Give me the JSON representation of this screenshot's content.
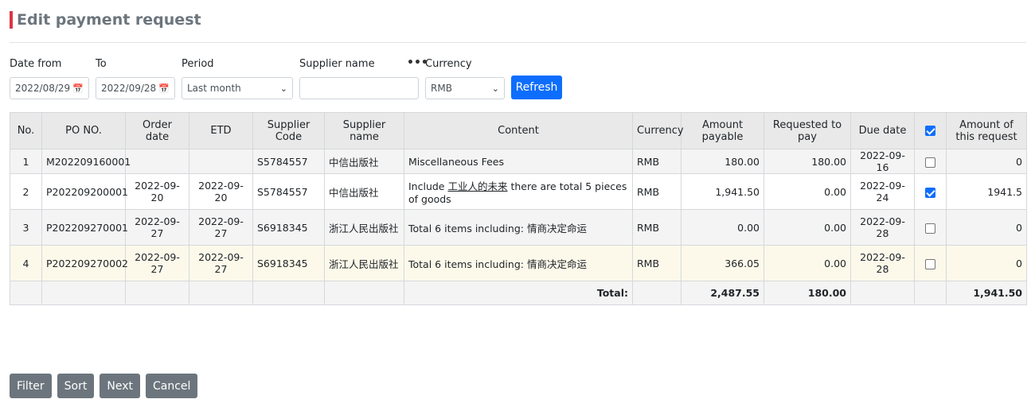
{
  "page": {
    "title": "Edit payment request"
  },
  "filters": {
    "date_from_label": "Date from",
    "to_label": "To",
    "period_label": "Period",
    "supplier_label": "Supplier name",
    "currency_label": "Currency",
    "date_from_value": "2022/08/29",
    "to_value": "2022/09/28",
    "period_value": "Last month",
    "supplier_value": "",
    "currency_value": "RMB",
    "refresh_label": "Refresh",
    "more_label": "•••"
  },
  "table": {
    "headers": {
      "no": "No.",
      "po": "PO NO.",
      "order_date": "Order date",
      "etd": "ETD",
      "supplier_code": "Supplier Code",
      "supplier_name": "Supplier name",
      "content": "Content",
      "currency": "Currency",
      "amount_payable": "Amount payable",
      "requested": "Requested to pay",
      "due_date": "Due date",
      "amount_request": "Amount of this request",
      "select_all_checked": true
    },
    "rows": [
      {
        "no": "1",
        "po": "M202209160001",
        "order_date": "",
        "etd": "",
        "supplier_code": "S5784557",
        "supplier_name": "中信出版社",
        "content_prefix": "Miscellaneous Fees",
        "content_link": "",
        "content_suffix": "",
        "currency": "RMB",
        "amount_payable": "180.00",
        "requested": "180.00",
        "due_date": "2022-09-16",
        "checked": false,
        "amount_request": "0"
      },
      {
        "no": "2",
        "po": "P202209200001",
        "order_date": "2022-09-20",
        "etd": "2022-09-20",
        "supplier_code": "S5784557",
        "supplier_name": "中信出版社",
        "content_prefix": "Include ",
        "content_link": "工业人的未来",
        "content_suffix": " there are total 5 pieces of goods",
        "currency": "RMB",
        "amount_payable": "1,941.50",
        "requested": "0.00",
        "due_date": "2022-09-24",
        "checked": true,
        "amount_request": "1941.5"
      },
      {
        "no": "3",
        "po": "P202209270001",
        "order_date": "2022-09-27",
        "etd": "2022-09-27",
        "supplier_code": "S6918345",
        "supplier_name": "浙江人民出版社",
        "content_prefix": "Total 6 items including: ",
        "content_link": "情商决定命运",
        "content_suffix": "",
        "currency": "RMB",
        "amount_payable": "0.00",
        "requested": "0.00",
        "due_date": "2022-09-28",
        "checked": false,
        "amount_request": "0"
      },
      {
        "no": "4",
        "po": "P202209270002",
        "order_date": "2022-09-27",
        "etd": "2022-09-27",
        "supplier_code": "S6918345",
        "supplier_name": "浙江人民出版社",
        "content_prefix": "Total 6 items including: ",
        "content_link": "情商决定命运",
        "content_suffix": "",
        "currency": "RMB",
        "amount_payable": "366.05",
        "requested": "0.00",
        "due_date": "2022-09-28",
        "checked": false,
        "amount_request": "0"
      }
    ],
    "total": {
      "label": "Total:",
      "amount_payable": "2,487.55",
      "requested": "180.00",
      "amount_request": "1,941.50"
    }
  },
  "actions": {
    "filter": "Filter",
    "sort": "Sort",
    "next": "Next",
    "cancel": "Cancel"
  },
  "colors": {
    "accent": "#dc3545",
    "primary": "#0d6efd",
    "secondary": "#6c757d",
    "highlight_row": "#fdf9ea"
  }
}
